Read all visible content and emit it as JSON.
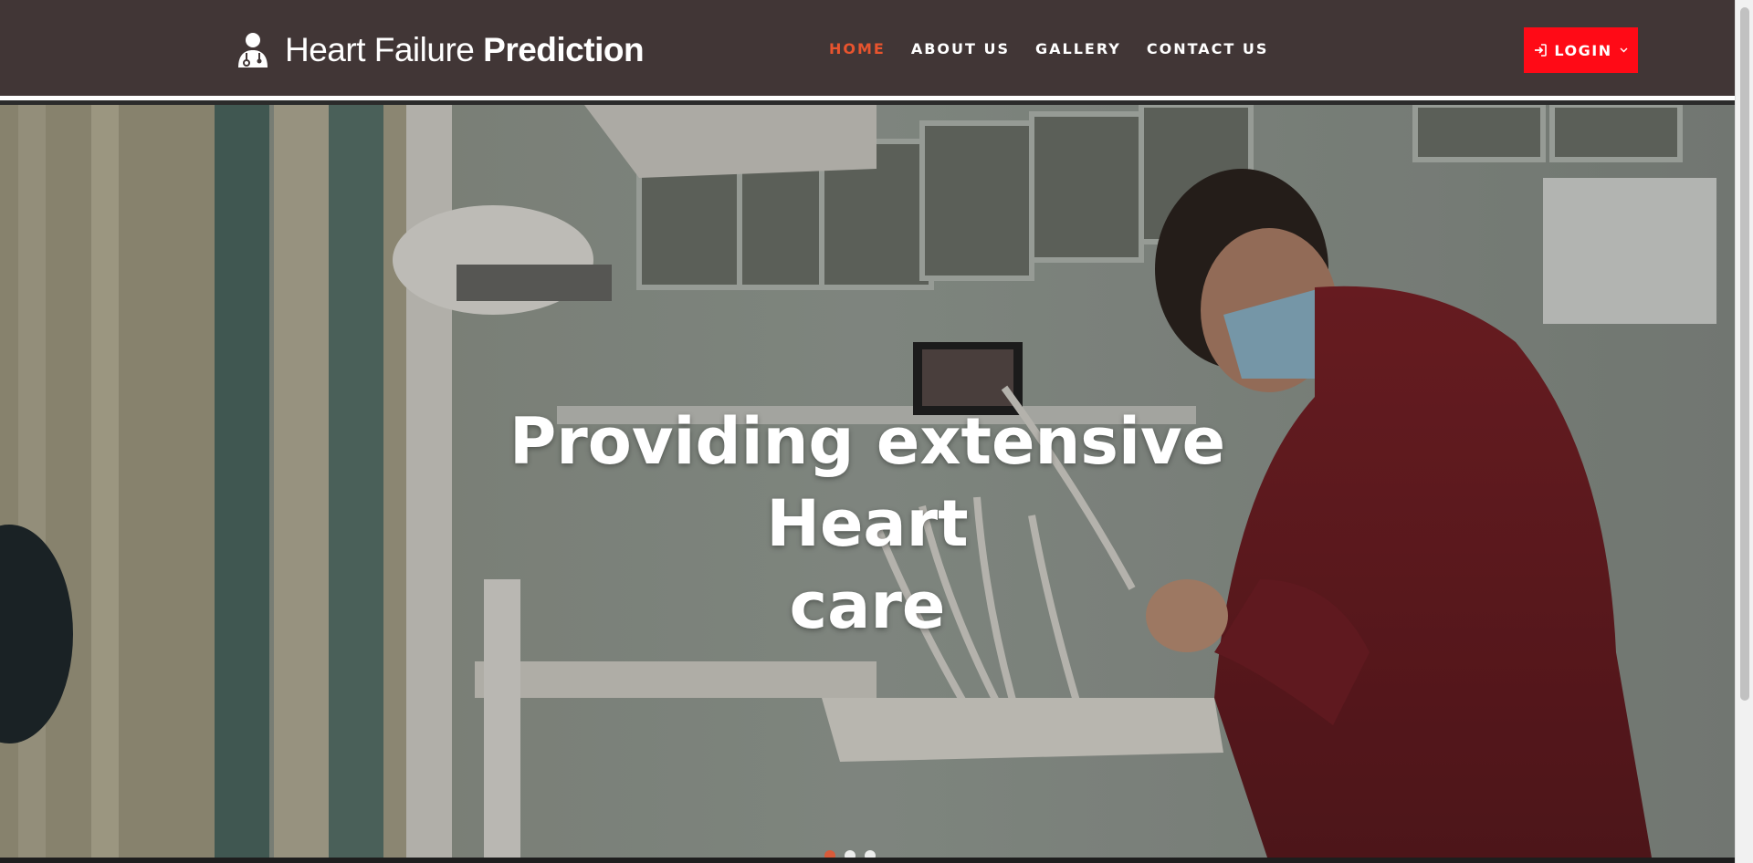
{
  "brand": {
    "light": "Heart Failure",
    "bold": "Prediction",
    "icon": "doctor-icon"
  },
  "nav": {
    "items": [
      {
        "label": "HOME",
        "active": true
      },
      {
        "label": "ABOUT US",
        "active": false
      },
      {
        "label": "GALLERY",
        "active": false
      },
      {
        "label": "CONTACT US",
        "active": false
      }
    ]
  },
  "login": {
    "label": "LOGIN",
    "icon": "sign-in-icon",
    "caret": "chevron-down-icon"
  },
  "hero": {
    "title_line1": "Providing extensive Heart",
    "title_line2": "care"
  },
  "carousel": {
    "slides": 3,
    "active": 1
  },
  "colors": {
    "header_bg": "#413636",
    "accent": "#e8542e",
    "login_bg": "#ff0a16"
  }
}
